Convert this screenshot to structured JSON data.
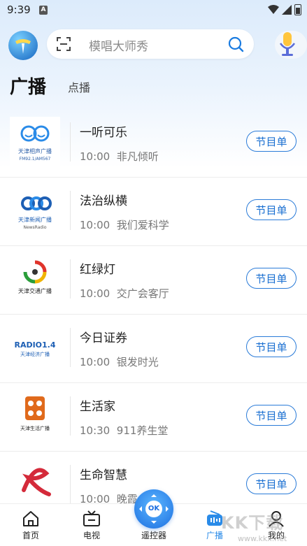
{
  "status_bar": {
    "time": "9:39",
    "sim_label": "A"
  },
  "search": {
    "placeholder": "模唱大师秀"
  },
  "tabs": [
    {
      "label": "广播"
    },
    {
      "label": "点播"
    }
  ],
  "stations": [
    {
      "name": "一听可乐",
      "time": "10:00",
      "program": "非凡倾听",
      "button": "节目单",
      "logo_lines": [
        "天津相声广播",
        "FM92.1/AM567"
      ],
      "logo_color": "#2a8be8"
    },
    {
      "name": "法治纵横",
      "time": "10:00",
      "program": "我们爱科学",
      "button": "节目单",
      "logo_lines": [
        "天津新闻广播",
        "NewsRadio"
      ],
      "logo_color": "#1d5fb4"
    },
    {
      "name": "红绿灯",
      "time": "10:00",
      "program": "交广会客厅",
      "button": "节目单",
      "logo_lines": [
        "天津交通广播"
      ],
      "logo_color": "#e0342b"
    },
    {
      "name": "今日证券",
      "time": "10:00",
      "program": "银发时光",
      "button": "节目单",
      "logo_lines": [
        "RADIO1.4",
        "天津经济广播"
      ],
      "logo_color": "#1d5fb4"
    },
    {
      "name": "生活家",
      "time": "10:30",
      "program": "911养生堂",
      "button": "节目单",
      "logo_lines": [
        "天津生活广播"
      ],
      "logo_color": "#e06a1c"
    },
    {
      "name": "生命智慧",
      "time": "10:00",
      "program": "晚霞",
      "button": "节目单",
      "logo_lines": [],
      "logo_color": "#d42a3a"
    }
  ],
  "bottom_nav": [
    {
      "label": "首页",
      "icon": "home-icon"
    },
    {
      "label": "电视",
      "icon": "tv-icon"
    },
    {
      "label": "遥控器",
      "icon": "remote-icon"
    },
    {
      "label": "广播",
      "icon": "radio-icon"
    },
    {
      "label": "我的",
      "icon": "profile-icon"
    }
  ],
  "remote_button": {
    "label": "OK"
  },
  "watermark": {
    "text": "KK下载",
    "url": "www.kkx.net"
  },
  "colors": {
    "accent": "#2a8be8",
    "button_border": "#2a7bd8"
  }
}
